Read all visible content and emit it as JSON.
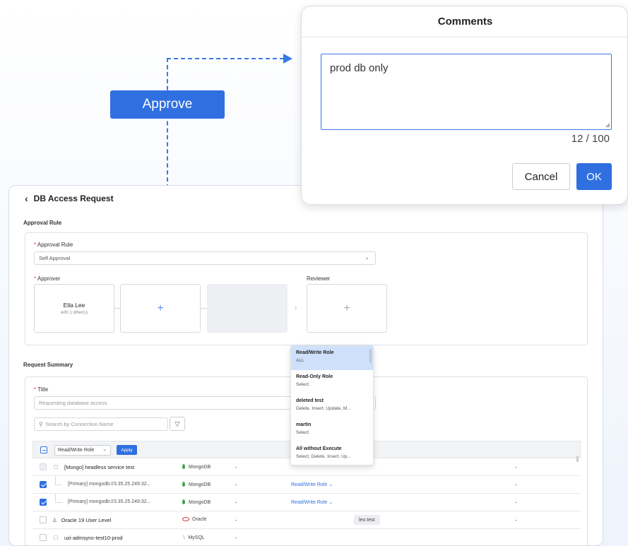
{
  "callout": {
    "label": "Approve"
  },
  "modal": {
    "title": "Comments",
    "comment_value": "prod db only",
    "counter": "12 / 100",
    "cancel_label": "Cancel",
    "ok_label": "OK"
  },
  "page": {
    "back_icon": "chevron-left-icon",
    "title": "DB Access Request"
  },
  "approval": {
    "section_title": "Approval Rule",
    "rule_label": "Approval Rule",
    "rule_value": "Self Approval",
    "approver_label": "Approver",
    "approver_name": "Ella Lee",
    "approver_sub": "with 1 other(s)",
    "add_symbol": "+",
    "reviewer_label": "Reviewer",
    "chevron": "›"
  },
  "summary": {
    "section_title": "Request Summary",
    "title_label": "Title",
    "title_placeholder": "Requesting database access",
    "search_placeholder": "Search by Connection Name",
    "role_select_value": "Read/Write Role",
    "apply_label": "Apply"
  },
  "rows": [
    {
      "name": "[Mongo] headless service test",
      "db": "MongoDB",
      "dash1": "-",
      "role": "",
      "dash2": "-"
    },
    {
      "name": "[Primary] mongodb://3.35.25.249:32...",
      "db": "MongoDB",
      "dash1": "-",
      "role": "Read/Write Role",
      "dash2": "-"
    },
    {
      "name": "[Primary] mongodb://3.35.25.249:32...",
      "db": "MongoDB",
      "dash1": "-",
      "role": "Read/Write Role",
      "dash2": "-"
    },
    {
      "name": "Oracle 19 User Level",
      "db": "Oracle",
      "dash1": "-",
      "pill": "leo test",
      "dash2": "-"
    },
    {
      "name": "uzi-admsync-test10-prod",
      "db": "MySQL",
      "dash1": "-",
      "dash2": "-"
    }
  ],
  "dropdown": [
    {
      "title": "Read/Write Role",
      "sub": "ALL"
    },
    {
      "title": "Read-Only Role",
      "sub": "Select"
    },
    {
      "title": "deleted test",
      "sub": "Delete, Insert, Update, M..."
    },
    {
      "title": "martin",
      "sub": "Select"
    },
    {
      "title": "All without Execute",
      "sub": "Select, Delete, Insert, Up..."
    }
  ],
  "colors": {
    "accent": "#2f6fe0",
    "required": "#e53935",
    "dropdown_selected": "#cfe0fb"
  }
}
